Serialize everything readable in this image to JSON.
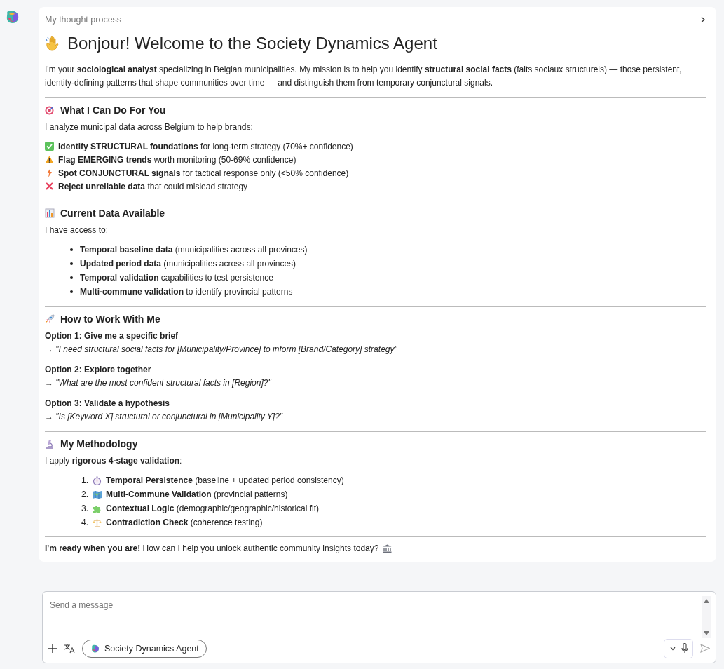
{
  "thought_process": {
    "label": "My thought process",
    "expanded": false
  },
  "message": {
    "title": "Bonjour! Welcome to the Society Dynamics Agent",
    "intro": "I'm your **sociological analyst** specializing in Belgian municipalities. My mission is to help you identify **structural social facts** (faits sociaux structurels) — those persistent, identity-defining patterns that shape communities over time — and distinguish them from temporary conjunctural signals.",
    "sections": [
      {
        "kind": "icons",
        "heading": "What I Can Do For You",
        "lead": "I analyze municipal data across Belgium to help brands:",
        "items": [
          {
            "text": "**Identify STRUCTURAL foundations** for long-term strategy (70%+ confidence)"
          },
          {
            "text": "**Flag EMERGING trends** worth monitoring (50-69% confidence)"
          },
          {
            "text": "**Spot CONJUNCTURAL signals** for tactical response only (<50% confidence)"
          },
          {
            "text": "**Reject unreliable data** that could mislead strategy"
          }
        ]
      },
      {
        "kind": "bullets",
        "heading": "Current Data Available",
        "lead": "I have access to:",
        "items": [
          {
            "text": "**Temporal baseline data** (municipalities across all provinces)"
          },
          {
            "text": "**Updated period data** (municipalities across all provinces)"
          },
          {
            "text": "**Temporal validation** capabilities to test persistence"
          },
          {
            "text": "**Multi-commune validation** to identify provincial patterns"
          }
        ]
      },
      {
        "kind": "options",
        "heading": "How to Work With Me",
        "items": [
          {
            "label": "Option 1: Give me a specific brief",
            "example": "→ *\"I need structural social facts for [Municipality/Province] to inform [Brand/Category] strategy\"*"
          },
          {
            "label": "Option 2: Explore together",
            "example": "→ *\"What are the most confident structural facts in [Region]?\"*"
          },
          {
            "label": "Option 3: Validate a hypothesis",
            "example": "→ *\"Is [Keyword X] structural or conjunctural in [Municipality Y]?\"*"
          }
        ]
      },
      {
        "kind": "numbered",
        "heading": "My Methodology",
        "lead": "I apply **rigorous 4-stage validation**:",
        "items": [
          {
            "number": "1.",
            "text": "**Temporal Persistence** (baseline + updated period consistency)"
          },
          {
            "number": "2.",
            "text": "**Multi-Commune Validation** (provincial patterns)"
          },
          {
            "number": "3.",
            "text": "**Contextual Logic** (demographic/geographic/historical fit)"
          },
          {
            "number": "4.",
            "text": "**Contradiction Check** (coherence testing)"
          }
        ]
      }
    ],
    "closing": "**I'm ready when you are!** How can I help you unlock authentic community insights today?"
  },
  "composer": {
    "placeholder": "Send a message",
    "agent": "Society Dynamics Agent",
    "send_disabled": true
  }
}
